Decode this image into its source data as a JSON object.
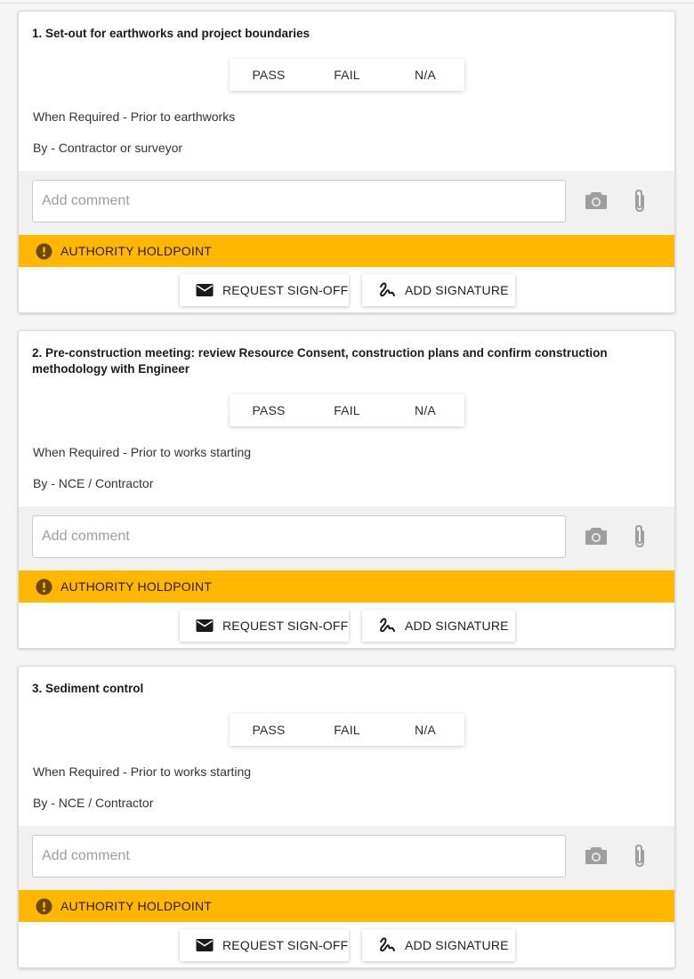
{
  "items": [
    {
      "title": "1. Set-out for earthworks and project boundaries",
      "when": "When Required - Prior to earthworks",
      "by": "By - Contractor or surveyor"
    },
    {
      "title": "2. Pre-construction meeting: review Resource Consent, construction plans and confirm construction methodology with Engineer",
      "when": "When Required - Prior to works starting",
      "by": "By - NCE / Contractor"
    },
    {
      "title": "3. Sediment control",
      "when": "When Required - Prior to works starting",
      "by": "By - NCE / Contractor"
    }
  ],
  "options": {
    "pass": "PASS",
    "fail": "FAIL",
    "na": "N/A"
  },
  "comment": {
    "placeholder": "Add comment",
    "value": ""
  },
  "holdpoint": {
    "label": "AUTHORITY HOLDPOINT",
    "color": "#ffb700"
  },
  "actions": {
    "request_signoff": "REQUEST SIGN-OFF",
    "add_signature": "ADD SIGNATURE"
  },
  "icons": {
    "camera": "camera-icon",
    "attach": "paperclip-icon",
    "warning": "exclamation-icon",
    "mail": "envelope-icon",
    "signature": "signature-icon"
  }
}
